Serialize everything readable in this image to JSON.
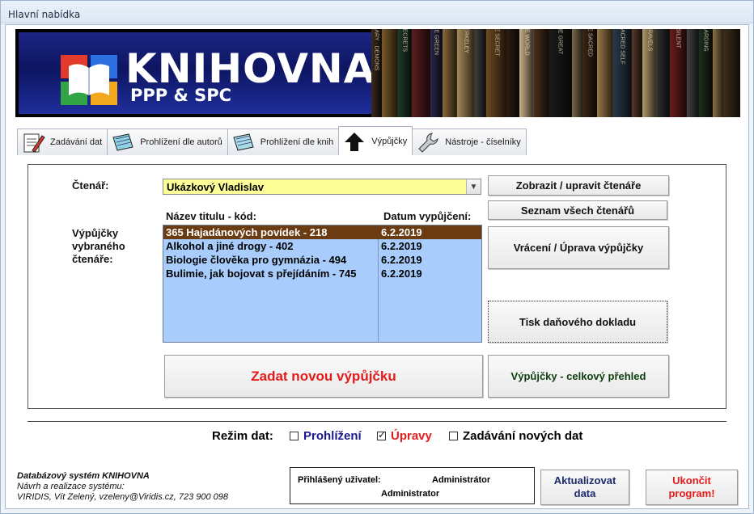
{
  "window": {
    "title": "Hlavní nabídka"
  },
  "banner": {
    "title": "KNIHOVNA",
    "subtitle": "PPP & SPC",
    "book_spines": [
      "DICTIONARY · DEMONS",
      "SECRETS",
      "THE GREEN",
      "BERKELEY",
      "THE SECRET",
      "THE WORLD",
      "THE GREAT",
      "THE SACRED",
      "THE SACRED SELF",
      "TRAVELS",
      "SILENT",
      "HARDING"
    ]
  },
  "tabs": [
    {
      "label": "Zadávání dat",
      "icon": "pencil-form-icon",
      "active": false
    },
    {
      "label": "Prohlížení dle autorů",
      "icon": "notebook-icon",
      "active": false
    },
    {
      "label": "Prohlížení dle knih",
      "icon": "notepad-icon",
      "active": false
    },
    {
      "label": "Výpůjčky",
      "icon": "up-arrow-icon",
      "active": true
    },
    {
      "label": "Nástroje - číselníky",
      "icon": "wrench-icon",
      "active": false
    }
  ],
  "reader": {
    "label": "Čtenář:",
    "selected": "Ukázkový Vladislav"
  },
  "buttons": {
    "show_edit_reader": "Zobrazit / upravit čtenáře",
    "all_readers": "Seznam všech čtenářů",
    "return_edit_loan": "Vrácení / Úprava výpůjčky",
    "print_tax_doc": "Tisk daňového dokladu",
    "new_loan": "Zadat novou výpůjčku",
    "loans_overview": "Výpůjčky - celkový přehled",
    "refresh_line1": "Aktualizovat",
    "refresh_line2": "data",
    "exit_line1": "Ukončit",
    "exit_line2": "program!"
  },
  "loans": {
    "label_line1": "Výpůjčky",
    "label_line2": "vybraného",
    "label_line3": "čtenáře:",
    "col_title": "Název titulu - kód:",
    "col_date": "Datum vypůjčení:",
    "rows": [
      {
        "title": "365 Hajadánových povídek - 218",
        "date": "6.2.2019",
        "selected": true
      },
      {
        "title": "Alkohol a jiné drogy - 402",
        "date": "6.2.2019",
        "selected": false
      },
      {
        "title": "Biologie člověka pro gymnázia - 494",
        "date": "6.2.2019",
        "selected": false
      },
      {
        "title": "Bulimie, jak bojovat s přejídáním - 745",
        "date": "6.2.2019",
        "selected": false
      }
    ]
  },
  "mode": {
    "label": "Režim dat:",
    "browse": "Prohlížení",
    "edit": "Úpravy",
    "new": "Zadávání nových dat",
    "browse_checked": false,
    "edit_checked": true,
    "new_checked": false,
    "browse_color": "#1a1a8c",
    "edit_color": "#e41b1b"
  },
  "footer": {
    "system": "Databázový systém KNIHOVNA",
    "design": "Návrh a realizace systému:",
    "author": "VIRIDIS, Vít Zelený, vzeleny@Viridis.cz, 723 900 098"
  },
  "user": {
    "label": "Přihlášený uživatel:",
    "name": "Administrátor",
    "role": "Administrator"
  }
}
